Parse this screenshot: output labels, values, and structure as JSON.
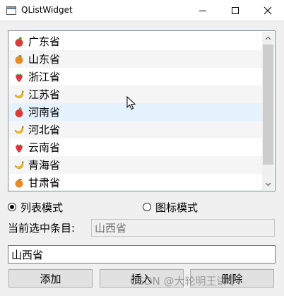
{
  "window": {
    "title": "QListWidget",
    "app_icon": "qt-window-icon",
    "controls": [
      "minimize-icon",
      "maximize-icon",
      "close-icon"
    ]
  },
  "list": {
    "items": [
      {
        "label": "广东省",
        "icon": "apple-icon"
      },
      {
        "label": "山东省",
        "icon": "orange-icon"
      },
      {
        "label": "浙江省",
        "icon": "strawberry-icon"
      },
      {
        "label": "江苏省",
        "icon": "banana-icon"
      },
      {
        "label": "河南省",
        "icon": "apple-icon"
      },
      {
        "label": "河北省",
        "icon": "banana-icon"
      },
      {
        "label": "云南省",
        "icon": "strawberry-icon"
      },
      {
        "label": "青海省",
        "icon": "banana-icon"
      },
      {
        "label": "甘肃省",
        "icon": "orange-icon"
      }
    ],
    "hovered_index": 4
  },
  "view_mode": {
    "list_mode_label": "列表模式",
    "icon_mode_label": "图标模式",
    "selected": "list"
  },
  "current": {
    "label": "当前选中条目:",
    "value": "山西省"
  },
  "input": {
    "value": "山西省"
  },
  "buttons": {
    "add": "添加",
    "insert": "插入",
    "delete": "删除"
  },
  "watermark": "CSDN @大轮明王讲QT",
  "colors": {
    "apple": "#d93a3a",
    "orange": "#e88a2a",
    "strawberry": "#e0253a",
    "banana": "#f2c31b",
    "hover_row": "#e5f3ff"
  }
}
